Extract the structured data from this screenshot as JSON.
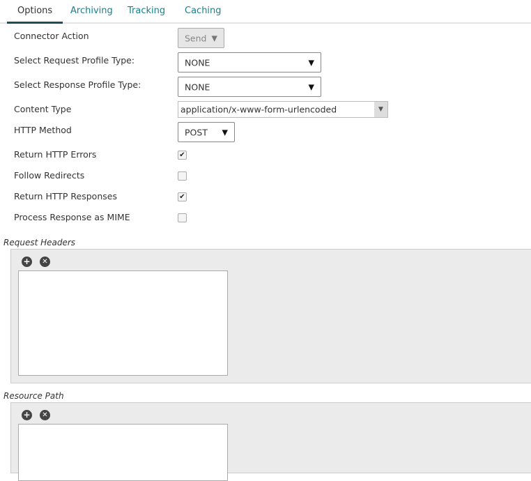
{
  "tabs": [
    "Options",
    "Archiving",
    "Tracking",
    "Caching"
  ],
  "fields": {
    "connector_action": {
      "label": "Connector Action",
      "value": "Send"
    },
    "request_profile": {
      "label": "Select Request Profile Type:",
      "value": "NONE"
    },
    "response_profile": {
      "label": "Select Response Profile Type:",
      "value": "NONE"
    },
    "content_type": {
      "label": "Content Type",
      "value": "application/x-www-form-urlencoded"
    },
    "http_method": {
      "label": "HTTP Method",
      "value": "POST"
    }
  },
  "checkboxes": [
    {
      "label": "Return HTTP Errors",
      "checked": true
    },
    {
      "label": "Follow Redirects",
      "checked": false
    },
    {
      "label": "Return HTTP Responses",
      "checked": true
    },
    {
      "label": "Process Response as MIME",
      "checked": false
    }
  ],
  "sections": {
    "request_headers": "Request Headers",
    "resource_path": "Resource Path"
  },
  "icons": {
    "add": "plus-circle-icon",
    "remove": "x-circle-icon",
    "arrow": "▼",
    "check": "✔"
  }
}
